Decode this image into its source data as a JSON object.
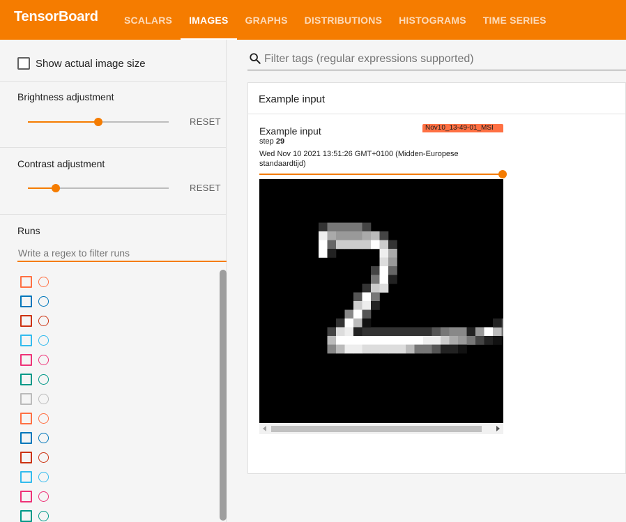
{
  "header": {
    "brand": "TensorBoard",
    "tabs": [
      {
        "label": "SCALARS",
        "active": false
      },
      {
        "label": "IMAGES",
        "active": true
      },
      {
        "label": "GRAPHS",
        "active": false
      },
      {
        "label": "DISTRIBUTIONS",
        "active": false
      },
      {
        "label": "HISTOGRAMS",
        "active": false
      },
      {
        "label": "TIME SERIES",
        "active": false
      }
    ],
    "accent_color": "#f57c00"
  },
  "sidebar": {
    "show_actual_size": {
      "label": "Show actual image size",
      "checked": false
    },
    "brightness": {
      "label": "Brightness adjustment",
      "value_fraction": 0.5,
      "reset_label": "RESET"
    },
    "contrast": {
      "label": "Contrast adjustment",
      "value_fraction": 0.2,
      "reset_label": "RESET"
    },
    "runs": {
      "title": "Runs",
      "filter_placeholder": "Write a regex to filter runs",
      "run_colors": [
        "#ff7043",
        "#0077bb",
        "#cc3311",
        "#33bbee",
        "#ee3377",
        "#009988",
        "#bbbbbb",
        "#ff7043",
        "#0077bb",
        "#cc3311",
        "#33bbee",
        "#ee3377",
        "#009988"
      ]
    }
  },
  "main": {
    "filter": {
      "placeholder": "Filter tags (regular expressions supported)"
    },
    "card": {
      "title": "Example input",
      "image": {
        "title": "Example input",
        "run_badge": "Nov10_13-49-01_MSI",
        "step_label": "step",
        "step_value": "29",
        "timestamp": "Wed Nov 10 2021 13:51:26 GMT+0100 (Midden-Europese standaardtijd)",
        "step_slider_fraction": 1.0,
        "icon": "mnist-digit-2"
      }
    }
  }
}
